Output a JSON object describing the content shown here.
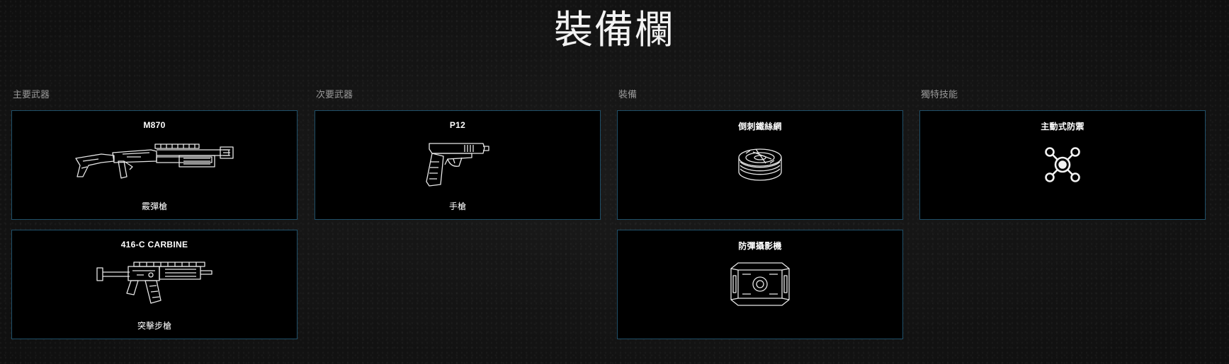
{
  "page": {
    "title": "裝備欄"
  },
  "columns": [
    {
      "label": "主要武器",
      "cards": [
        {
          "name": "M870",
          "type": "霰彈槍",
          "icon": "shotgun-icon"
        },
        {
          "name": "416-C CARBINE",
          "type": "突擊步槍",
          "icon": "assault-rifle-icon"
        }
      ]
    },
    {
      "label": "次要武器",
      "cards": [
        {
          "name": "P12",
          "type": "手槍",
          "icon": "pistol-icon"
        }
      ]
    },
    {
      "label": "裝備",
      "cards": [
        {
          "name": "倒刺鐵絲網",
          "type": "",
          "icon": "barbed-wire-icon"
        },
        {
          "name": "防彈攝影機",
          "type": "",
          "icon": "bulletproof-camera-icon"
        }
      ]
    },
    {
      "label": "獨特技能",
      "cards": [
        {
          "name": "主動式防禦",
          "type": "",
          "icon": "active-defense-icon"
        }
      ]
    }
  ],
  "colors": {
    "card_border": "#1f4f68",
    "card_background": "#000000",
    "text": "#ffffff",
    "label": "#9a9a9a"
  }
}
